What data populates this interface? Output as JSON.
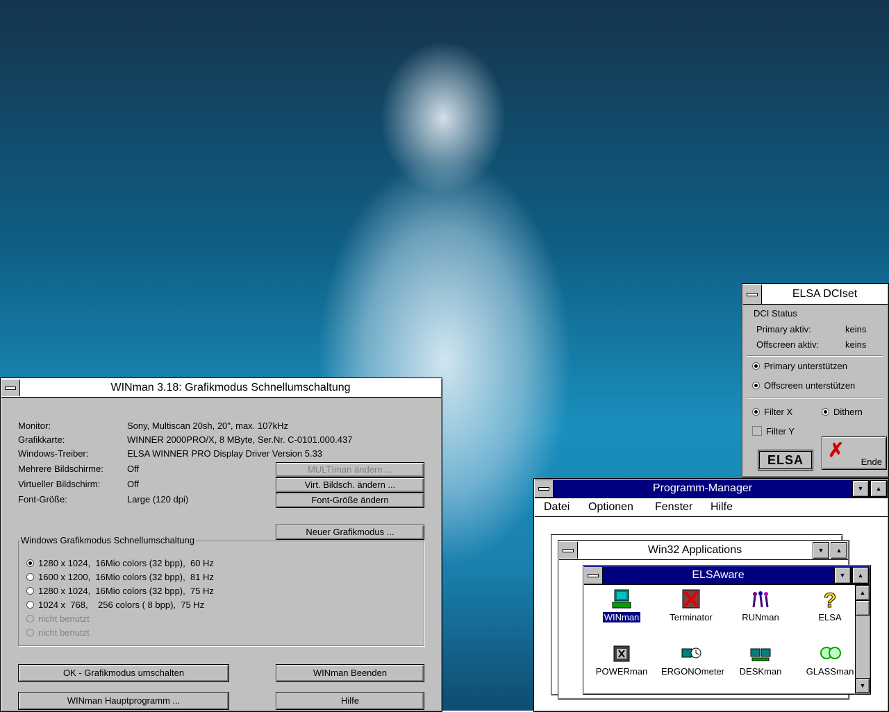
{
  "winman": {
    "title": "WINman 3.18: Grafikmodus Schnellumschaltung",
    "info": [
      {
        "label": "Monitor:",
        "value": "Sony, Multiscan 20sh, 20\", max. 107kHz"
      },
      {
        "label": "Grafikkarte:",
        "value": "WINNER 2000PRO/X, 8 MByte, Ser.Nr. C-0101.000.437"
      },
      {
        "label": "Windows-Treiber:",
        "value": "ELSA WINNER PRO Display Driver Version 5.33"
      },
      {
        "label": "Mehrere Bildschirme:",
        "value": "Off"
      },
      {
        "label": "Virtueller Bildschirm:",
        "value": "Off"
      },
      {
        "label": "Font-Größe:",
        "value": "Large (120 dpi)"
      }
    ],
    "buttons": {
      "multiman": "MULTIman ändern ...",
      "virt": "Virt. Bildsch. ändern ...",
      "font": "Font-Größe ändern",
      "neuer": "Neuer Grafikmodus ...",
      "ok": "OK - Grafikmodus umschalten",
      "beenden": "WINman Beenden",
      "haupt": "WINman Hauptprogramm ...",
      "hilfe": "Hilfe"
    },
    "group_label": "Windows Grafikmodus Schnellumschaltung",
    "modes": [
      {
        "label": "1280 x 1024,  16Mio colors (32 bpp),  60 Hz",
        "selected": true,
        "enabled": true
      },
      {
        "label": "1600 x 1200,  16Mio colors (32 bpp),  81 Hz",
        "selected": false,
        "enabled": true
      },
      {
        "label": "1280 x 1024,  16Mio colors (32 bpp),  75 Hz",
        "selected": false,
        "enabled": true
      },
      {
        "label": "1024 x  768,    256 colors ( 8 bpp),  75 Hz",
        "selected": false,
        "enabled": true
      },
      {
        "label": "nicht benutzt",
        "selected": false,
        "enabled": false
      },
      {
        "label": "nicht benutzt",
        "selected": false,
        "enabled": false
      }
    ]
  },
  "dciset": {
    "title": "ELSA DCIset",
    "status_header": "DCI Status",
    "primary_label": "Primary aktiv:",
    "primary_value": "keins",
    "offscreen_label": "Offscreen aktiv:",
    "offscreen_value": "keins",
    "opt_primary": "Primary unterstützen",
    "opt_offscreen": "Offscreen unterstützen",
    "filter_x": "Filter X",
    "dithern": "Dithern",
    "filter_y": "Filter Y",
    "logo": "ELSA",
    "ende": "Ende"
  },
  "progman": {
    "title": "Programm-Manager",
    "menu": [
      "Datei",
      "Optionen",
      "Fenster",
      "Hilfe"
    ],
    "win32_title": "Win32 Applications",
    "elsaware_title": "ELSAware",
    "icons": [
      "WINman",
      "Terminator",
      "RUNman",
      "ELSA",
      "POWERman",
      "ERGONOmeter",
      "DESKman",
      "GLASSman"
    ]
  },
  "colors": {
    "active_title": "#000080",
    "window_face": "#c0c0c0"
  }
}
